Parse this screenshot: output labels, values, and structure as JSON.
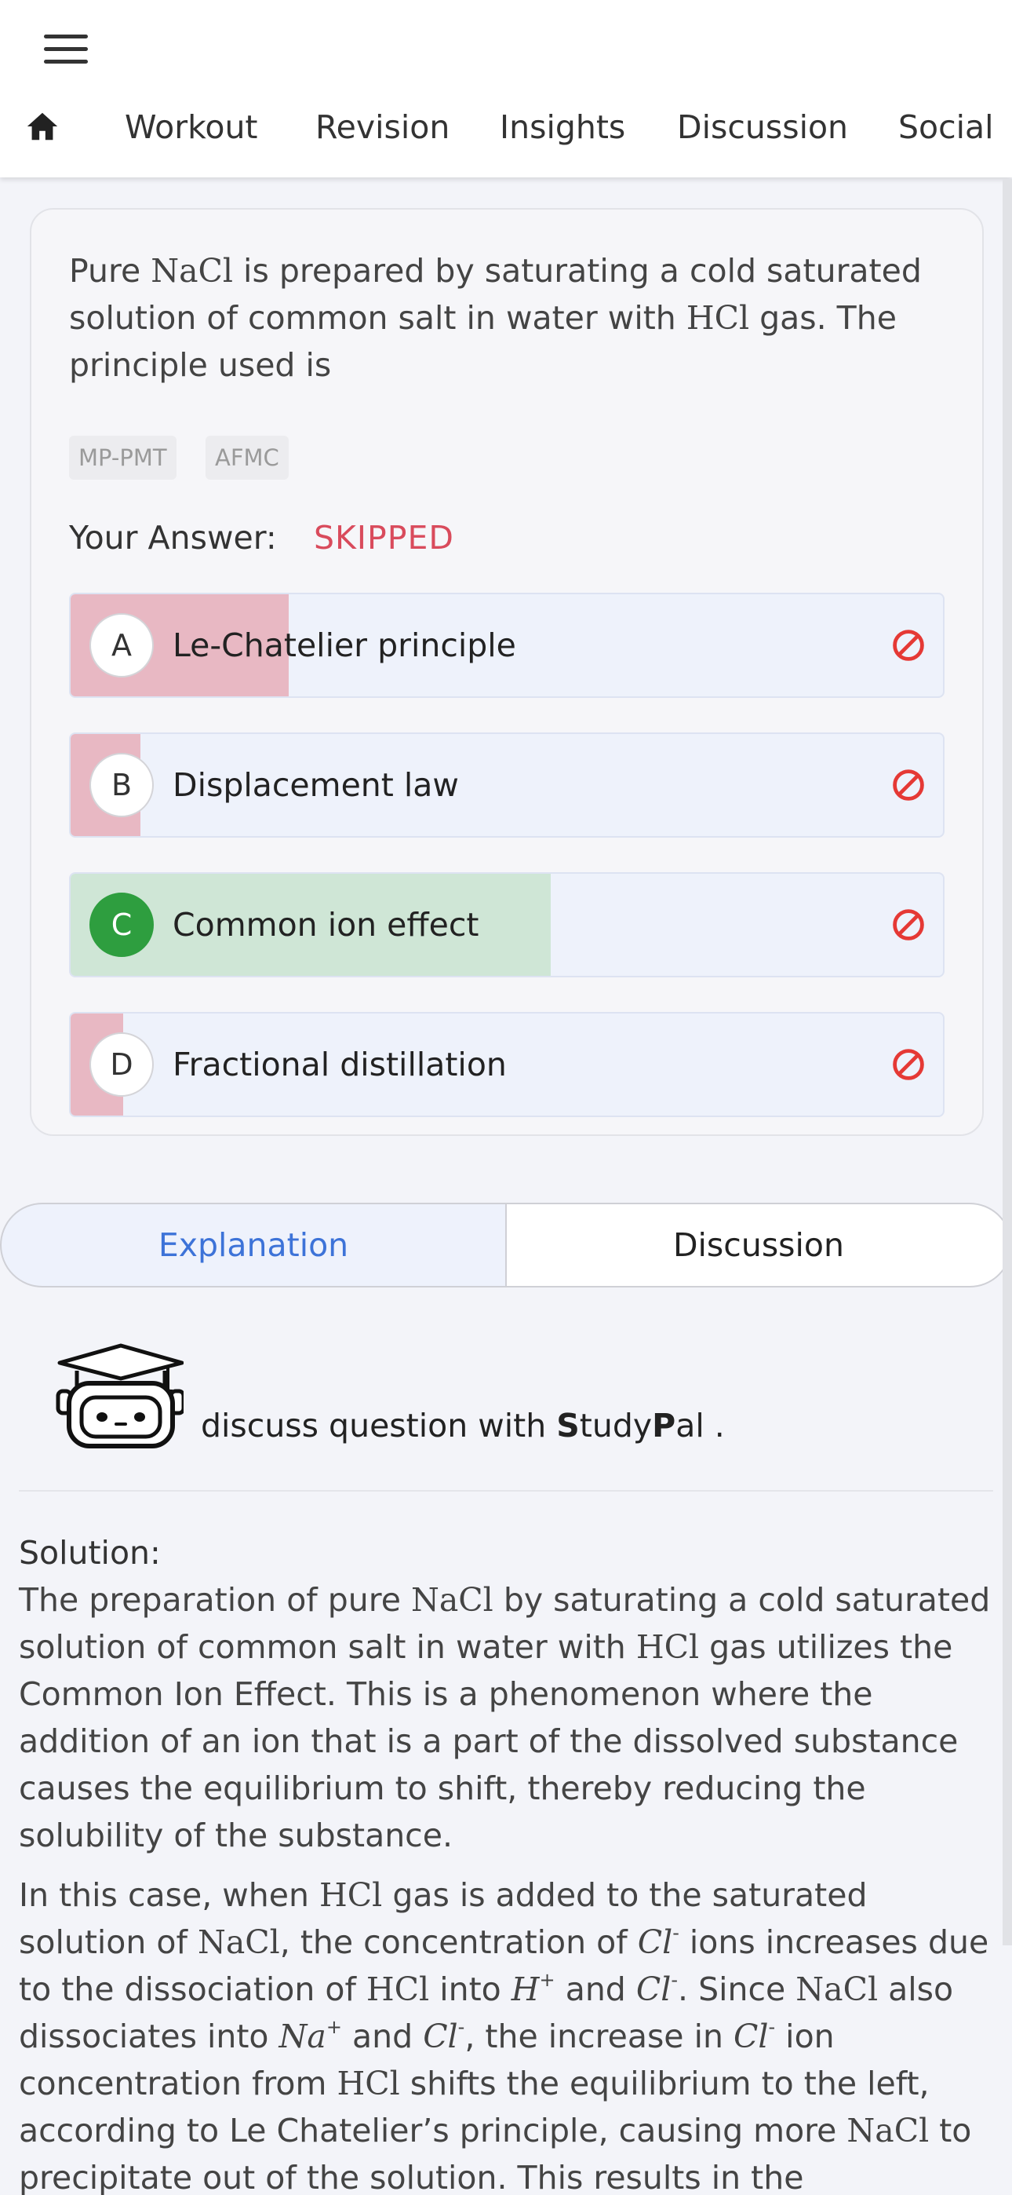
{
  "header": {
    "nav": [
      "Workout",
      "Revision",
      "Insights",
      "Discussion",
      "Social"
    ]
  },
  "question": {
    "text_parts": [
      "Pure ",
      "NaCl",
      " is prepared by saturating a cold saturated solution of common salt in water with ",
      "HCl",
      " gas. The principle used is"
    ],
    "tags": [
      "MP-PMT",
      "AFMC"
    ],
    "answer_label": "Your Answer:",
    "answer_value": "SKIPPED",
    "options": [
      {
        "letter": "A",
        "label": "Le-Chatelier principle",
        "response_share_percent": 25,
        "status": "wrong"
      },
      {
        "letter": "B",
        "label": "Displacement law",
        "response_share_percent": 8,
        "status": "wrong"
      },
      {
        "letter": "C",
        "label": "Common ion effect",
        "response_share_percent": 55,
        "status": "correct"
      },
      {
        "letter": "D",
        "label": "Fractional distillation",
        "response_share_percent": 6,
        "status": "wrong"
      }
    ]
  },
  "tabs": {
    "explanation": "Explanation",
    "discussion": "Discussion"
  },
  "studypal": {
    "prefix": "discuss question with ",
    "s": "S",
    "tudy": "tudy",
    "p": "P",
    "al": "al",
    "suffix": " ."
  },
  "solution": {
    "heading": "Solution:",
    "p1": [
      "The preparation of pure ",
      "NaCl",
      " by saturating a cold saturated solution of common salt in water with ",
      "HCl",
      " gas utilizes the Common Ion Effect. This is a phenomenon where the addition of an ion that is a part of the dissolved substance causes the equilibrium to shift, thereby reducing the solubility of the substance."
    ],
    "p2": [
      "In this case, when ",
      "HCl",
      " gas is added to the saturated solution of ",
      "NaCl",
      ", the concentration of ",
      "Cl",
      "-",
      " ions increases due to the dissociation of ",
      "HCl",
      " into ",
      "H",
      "+",
      " and ",
      "Cl",
      "-",
      ". Since ",
      "NaCl",
      " also dissociates into ",
      "Na",
      "+",
      " and ",
      "Cl",
      "-",
      ", the increase in ",
      "Cl",
      "-",
      " ion concentration from ",
      "HCl",
      " shifts the equilibrium to the left, according to Le Chatelier’s principle, causing more ",
      "NaCl",
      " to precipitate out of the solution. This results in the"
    ]
  },
  "colors": {
    "wrong_fill": "#e8b8c3",
    "correct_fill": "#cfe6d6",
    "option_bg": "#eef2fb",
    "accent_blue": "#3d73d8",
    "skipped_red": "#d94b5c",
    "correct_green": "#2e9e3f"
  },
  "icons": [
    "menu-icon",
    "home-icon",
    "ban-icon",
    "studypal-robot-icon"
  ]
}
